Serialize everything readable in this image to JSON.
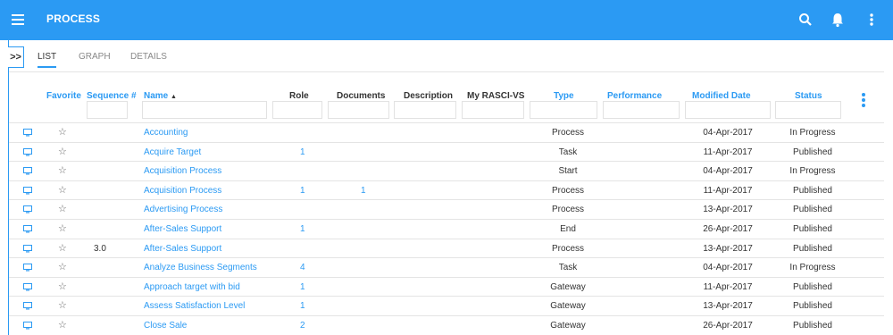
{
  "app": {
    "title": "PROCESS"
  },
  "toolbar": {
    "icons": [
      "menu-icon",
      "search-icon",
      "bell-icon",
      "more-vert-icon"
    ]
  },
  "expander": {
    "label": ">>"
  },
  "tabs": [
    {
      "label": "LIST",
      "active": true
    },
    {
      "label": "GRAPH",
      "active": false
    },
    {
      "label": "DETAILS",
      "active": false
    }
  ],
  "columns": {
    "favorite": "Favorite",
    "sequence": "Sequence #",
    "name": "Name",
    "name_sort": "▲",
    "role": "Role",
    "documents": "Documents",
    "description": "Description",
    "rasci": "My RASCI-VS",
    "type": "Type",
    "performance": "Performance",
    "modified": "Modified Date",
    "status": "Status"
  },
  "rows": [
    {
      "seq": "",
      "name": "Accounting",
      "role": "",
      "docs": "",
      "type": "Process",
      "modified": "04-Apr-2017",
      "status": "In Progress"
    },
    {
      "seq": "",
      "name": "Acquire Target",
      "role": "1",
      "docs": "",
      "type": "Task",
      "modified": "11-Apr-2017",
      "status": "Published"
    },
    {
      "seq": "",
      "name": "Acquisition Process",
      "role": "",
      "docs": "",
      "type": "Start",
      "modified": "04-Apr-2017",
      "status": "In Progress"
    },
    {
      "seq": "",
      "name": "Acquisition Process",
      "role": "1",
      "docs": "1",
      "type": "Process",
      "modified": "11-Apr-2017",
      "status": "Published"
    },
    {
      "seq": "",
      "name": "Advertising Process",
      "role": "",
      "docs": "",
      "type": "Process",
      "modified": "13-Apr-2017",
      "status": "Published"
    },
    {
      "seq": "",
      "name": "After-Sales Support",
      "role": "1",
      "docs": "",
      "type": "End",
      "modified": "26-Apr-2017",
      "status": "Published"
    },
    {
      "seq": "3.0",
      "name": "After-Sales Support",
      "role": "",
      "docs": "",
      "type": "Process",
      "modified": "13-Apr-2017",
      "status": "Published"
    },
    {
      "seq": "",
      "name": "Analyze Business Segments",
      "role": "4",
      "docs": "",
      "type": "Task",
      "modified": "04-Apr-2017",
      "status": "In Progress"
    },
    {
      "seq": "",
      "name": "Approach target with bid",
      "role": "1",
      "docs": "",
      "type": "Gateway",
      "modified": "11-Apr-2017",
      "status": "Published"
    },
    {
      "seq": "",
      "name": "Assess Satisfaction Level",
      "role": "1",
      "docs": "",
      "type": "Gateway",
      "modified": "13-Apr-2017",
      "status": "Published"
    },
    {
      "seq": "",
      "name": "Close Sale",
      "role": "2",
      "docs": "",
      "type": "Gateway",
      "modified": "26-Apr-2017",
      "status": "Published"
    }
  ],
  "row_icons": {
    "view": "monitor-icon",
    "favorite": "star-outline-icon",
    "favorite_glyph": "☆"
  },
  "colors": {
    "accent": "#2b9af3",
    "text": "#333333"
  }
}
